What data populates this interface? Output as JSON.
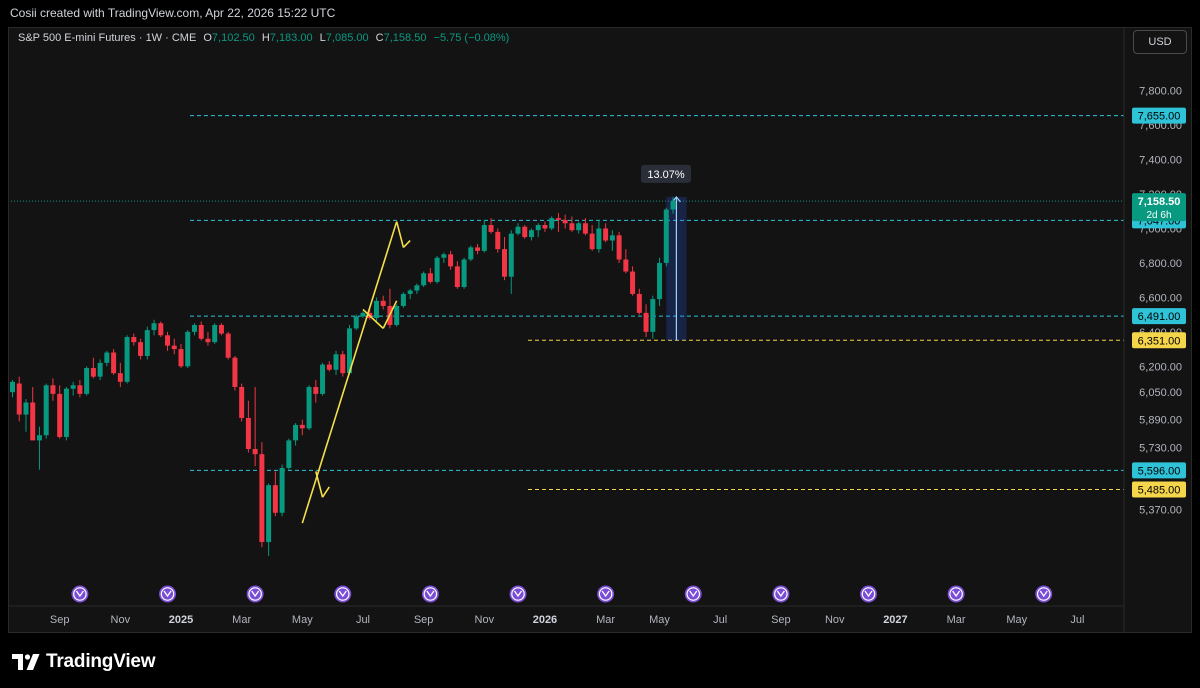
{
  "header": {
    "attribution": "Cosii created with TradingView.com, Apr 22, 2026 15:22 UTC"
  },
  "legend": {
    "symbol": "S&P 500 E-mini Futures · 1W · CME",
    "open_label": "O",
    "open": "7,102.50",
    "high_label": "H",
    "high": "7,183.00",
    "low_label": "L",
    "low": "7,085.00",
    "close_label": "C",
    "close": "7,158.50",
    "change": "−5.75 (−0.08%)"
  },
  "currency_button": "USD",
  "brand": {
    "name": "TradingView"
  },
  "colors": {
    "up": "#089981",
    "down": "#f23645",
    "level": "#2ec3d6",
    "yellow_level": "#f5d54a",
    "drawing": "#f5e04a",
    "marker": "#7a4dd6"
  },
  "chart_data": {
    "type": "candlestick",
    "interval": "1W",
    "ylim": [
      5290,
      8050
    ],
    "y_ticks": [
      {
        "label": "7,800.00",
        "value": 7800
      },
      {
        "label": "7,600.00",
        "value": 7600
      },
      {
        "label": "7,400.00",
        "value": 7400
      },
      {
        "label": "7,200.00",
        "value": 7200
      },
      {
        "label": "7,000.00",
        "value": 7000
      },
      {
        "label": "6,800.00",
        "value": 6800
      },
      {
        "label": "6,600.00",
        "value": 6600
      },
      {
        "label": "6,400.00",
        "value": 6400
      },
      {
        "label": "6,200.00",
        "value": 6200
      },
      {
        "label": "6,050.00",
        "value": 6050
      },
      {
        "label": "5,890.00",
        "value": 5890
      },
      {
        "label": "5,730.00",
        "value": 5730
      },
      {
        "label": "5,370.00",
        "value": 5370
      }
    ],
    "x_ticks": [
      {
        "label": "Sep",
        "bar": 7
      },
      {
        "label": "Nov",
        "bar": 16
      },
      {
        "label": "2025",
        "bar": 25
      },
      {
        "label": "Mar",
        "bar": 34
      },
      {
        "label": "May",
        "bar": 43
      },
      {
        "label": "Jul",
        "bar": 52
      },
      {
        "label": "Sep",
        "bar": 61
      },
      {
        "label": "Nov",
        "bar": 70
      },
      {
        "label": "2026",
        "bar": 79
      },
      {
        "label": "Mar",
        "bar": 88
      },
      {
        "label": "May",
        "bar": 96
      },
      {
        "label": "Jul",
        "bar": 105
      },
      {
        "label": "Sep",
        "bar": 114
      },
      {
        "label": "Nov",
        "bar": 122
      },
      {
        "label": "2027",
        "bar": 131
      },
      {
        "label": "Mar",
        "bar": 140
      },
      {
        "label": "May",
        "bar": 149
      },
      {
        "label": "Jul",
        "bar": 158
      },
      {
        "label": "Sep",
        "bar": 167
      }
    ],
    "event_marker_bars": [
      10,
      23,
      36,
      49,
      62,
      75,
      88,
      101,
      114,
      127,
      140,
      153
    ],
    "candles": [
      [
        6050,
        6120,
        6020,
        6110
      ],
      [
        6100,
        6140,
        5880,
        5920
      ],
      [
        5920,
        6010,
        5820,
        5990
      ],
      [
        5990,
        6080,
        5780,
        5770
      ],
      [
        5770,
        5850,
        5600,
        5800
      ],
      [
        5800,
        6100,
        5780,
        6090
      ],
      [
        6090,
        6130,
        6000,
        6040
      ],
      [
        6040,
        6090,
        5780,
        5790
      ],
      [
        5790,
        6080,
        5770,
        6070
      ],
      [
        6070,
        6110,
        6030,
        6090
      ],
      [
        6090,
        6120,
        6020,
        6040
      ],
      [
        6040,
        6200,
        6030,
        6190
      ],
      [
        6190,
        6250,
        6130,
        6140
      ],
      [
        6140,
        6240,
        6120,
        6220
      ],
      [
        6220,
        6290,
        6200,
        6280
      ],
      [
        6280,
        6300,
        6150,
        6160
      ],
      [
        6160,
        6220,
        6080,
        6110
      ],
      [
        6110,
        6380,
        6100,
        6370
      ],
      [
        6370,
        6390,
        6320,
        6340
      ],
      [
        6340,
        6360,
        6240,
        6260
      ],
      [
        6260,
        6430,
        6240,
        6410
      ],
      [
        6410,
        6470,
        6380,
        6450
      ],
      [
        6450,
        6460,
        6370,
        6380
      ],
      [
        6380,
        6400,
        6290,
        6320
      ],
      [
        6320,
        6360,
        6270,
        6300
      ],
      [
        6300,
        6330,
        6190,
        6200
      ],
      [
        6200,
        6410,
        6190,
        6400
      ],
      [
        6400,
        6450,
        6380,
        6440
      ],
      [
        6440,
        6460,
        6350,
        6360
      ],
      [
        6360,
        6400,
        6320,
        6340
      ],
      [
        6340,
        6450,
        6330,
        6440
      ],
      [
        6440,
        6450,
        6380,
        6390
      ],
      [
        6390,
        6400,
        6240,
        6250
      ],
      [
        6250,
        6260,
        6060,
        6080
      ],
      [
        6080,
        6100,
        5880,
        5900
      ],
      [
        5900,
        6000,
        5700,
        5720
      ],
      [
        5720,
        6080,
        5620,
        5690
      ],
      [
        5690,
        5760,
        5150,
        5180
      ],
      [
        5180,
        5520,
        5100,
        5510
      ],
      [
        5510,
        5590,
        5330,
        5350
      ],
      [
        5350,
        5630,
        5330,
        5610
      ],
      [
        5610,
        5780,
        5600,
        5770
      ],
      [
        5770,
        5870,
        5740,
        5860
      ],
      [
        5860,
        5890,
        5800,
        5840
      ],
      [
        5840,
        6090,
        5830,
        6080
      ],
      [
        6080,
        6120,
        5990,
        6040
      ],
      [
        6040,
        6220,
        6030,
        6210
      ],
      [
        6210,
        6230,
        6170,
        6180
      ],
      [
        6180,
        6290,
        6150,
        6270
      ],
      [
        6270,
        6290,
        6140,
        6160
      ],
      [
        6160,
        6440,
        6150,
        6420
      ],
      [
        6420,
        6500,
        6410,
        6490
      ],
      [
        6490,
        6520,
        6480,
        6510
      ],
      [
        6510,
        6540,
        6470,
        6480
      ],
      [
        6480,
        6600,
        6450,
        6580
      ],
      [
        6580,
        6610,
        6530,
        6550
      ],
      [
        6550,
        6650,
        6420,
        6440
      ],
      [
        6440,
        6560,
        6430,
        6550
      ],
      [
        6550,
        6630,
        6540,
        6620
      ],
      [
        6620,
        6650,
        6590,
        6640
      ],
      [
        6640,
        6680,
        6620,
        6670
      ],
      [
        6670,
        6750,
        6660,
        6740
      ],
      [
        6740,
        6770,
        6680,
        6690
      ],
      [
        6690,
        6840,
        6680,
        6830
      ],
      [
        6830,
        6860,
        6800,
        6850
      ],
      [
        6850,
        6870,
        6760,
        6780
      ],
      [
        6780,
        6810,
        6650,
        6660
      ],
      [
        6660,
        6830,
        6650,
        6820
      ],
      [
        6820,
        6900,
        6810,
        6890
      ],
      [
        6890,
        6910,
        6850,
        6870
      ],
      [
        6870,
        7050,
        6860,
        7020
      ],
      [
        7020,
        7060,
        6970,
        6980
      ],
      [
        6980,
        7000,
        6860,
        6880
      ],
      [
        6880,
        6950,
        6700,
        6720
      ],
      [
        6720,
        6990,
        6620,
        6970
      ],
      [
        6970,
        7030,
        6960,
        7010
      ],
      [
        7010,
        7020,
        6940,
        6950
      ],
      [
        6950,
        7000,
        6930,
        6990
      ],
      [
        6990,
        7030,
        6950,
        7020
      ],
      [
        7020,
        7040,
        6980,
        7000
      ],
      [
        7000,
        7070,
        6990,
        7060
      ],
      [
        7060,
        7090,
        6980,
        7050
      ],
      [
        7050,
        7080,
        7000,
        7030
      ],
      [
        7030,
        7070,
        6980,
        6990
      ],
      [
        6990,
        7040,
        6970,
        7030
      ],
      [
        7030,
        7060,
        6960,
        6970
      ],
      [
        6970,
        7020,
        6870,
        6880
      ],
      [
        6880,
        7050,
        6860,
        7000
      ],
      [
        7000,
        7030,
        6920,
        6930
      ],
      [
        6930,
        6990,
        6870,
        6960
      ],
      [
        6960,
        6980,
        6800,
        6820
      ],
      [
        6820,
        6880,
        6740,
        6750
      ],
      [
        6750,
        6780,
        6610,
        6620
      ],
      [
        6620,
        6650,
        6500,
        6510
      ],
      [
        6510,
        6560,
        6370,
        6400
      ],
      [
        6400,
        6610,
        6360,
        6590
      ],
      [
        6590,
        6830,
        6550,
        6800
      ],
      [
        6800,
        7120,
        6780,
        7110
      ],
      [
        7110,
        7183,
        7085,
        7158.5
      ]
    ],
    "horizontal_levels": [
      {
        "label": "7,655.00",
        "value": 7655,
        "style": "cyan-dashed"
      },
      {
        "label": "7,047.00",
        "value": 7047,
        "style": "cyan-dashed"
      },
      {
        "label": "6,491.00",
        "value": 6491,
        "style": "cyan-dashed"
      },
      {
        "label": "5,596.00",
        "value": 5596,
        "style": "cyan-dashed"
      },
      {
        "label": "6,351.00",
        "value": 6351,
        "style": "yellow-dashed"
      },
      {
        "label": "5,485.00",
        "value": 5485,
        "style": "yellow-dashed"
      }
    ],
    "last_price": {
      "label": "7,158.50",
      "countdown": "2d 6h",
      "value": 7158.5
    },
    "measure": {
      "label": "13.07%",
      "from": 6351,
      "to": 7183,
      "bar_start": 97,
      "bar_end": 100
    },
    "trendlines": [
      {
        "from": [
          43,
          5290
        ],
        "to": [
          57,
          7040
        ]
      },
      {
        "from": [
          52,
          6530
        ],
        "to": [
          55,
          6420
        ]
      },
      {
        "from": [
          55,
          6420
        ],
        "to": [
          57,
          6580
        ]
      },
      {
        "from": [
          57,
          7040
        ],
        "to": [
          58,
          6890
        ]
      },
      {
        "from": [
          58,
          6890
        ],
        "to": [
          59,
          6930
        ]
      },
      {
        "from": [
          45,
          5590
        ],
        "to": [
          46,
          5440
        ]
      },
      {
        "from": [
          46,
          5440
        ],
        "to": [
          47,
          5500
        ]
      }
    ]
  }
}
